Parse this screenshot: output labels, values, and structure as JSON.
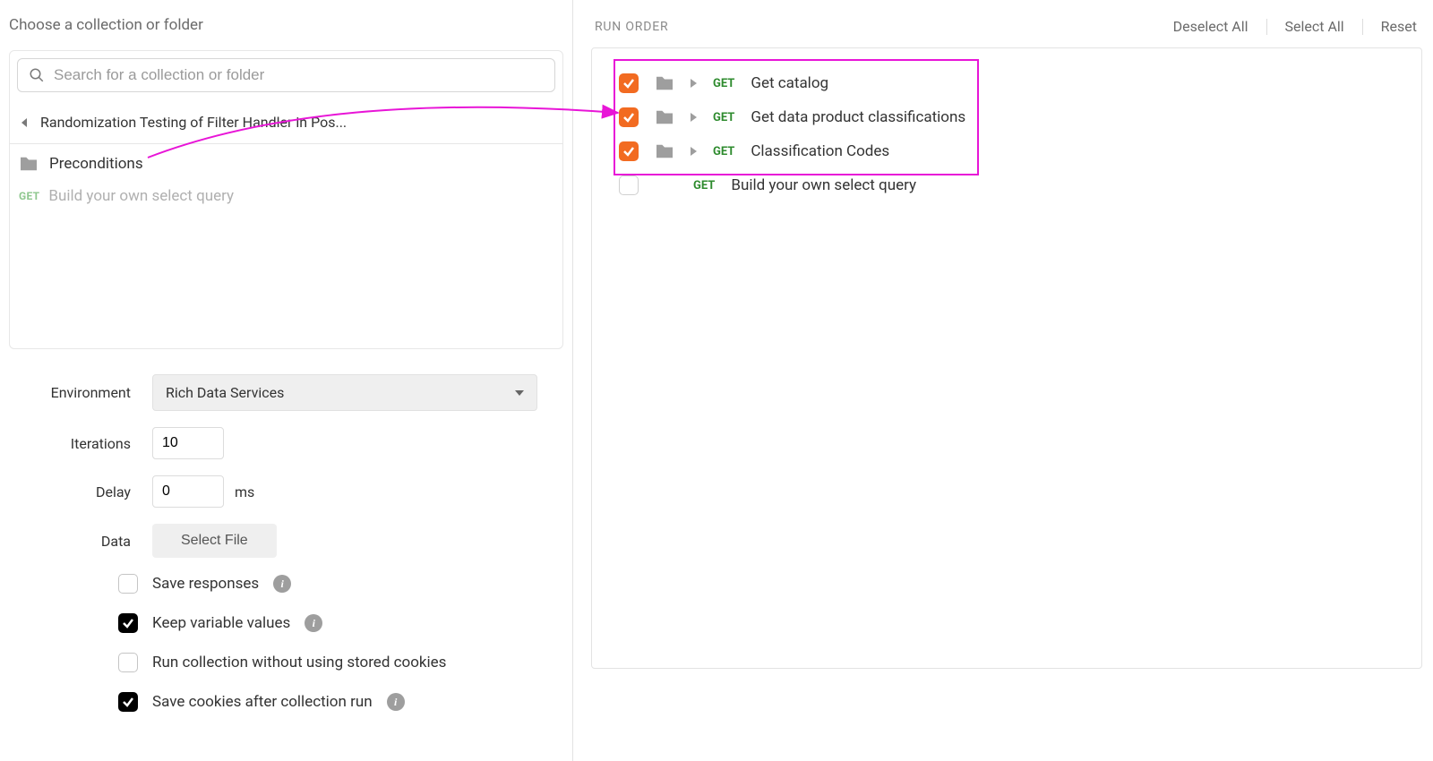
{
  "left": {
    "title": "Choose a collection or folder",
    "search_placeholder": "Search for a collection or folder",
    "breadcrumb": "Randomization Testing of Filter Handler in Pos...",
    "folder_name": "Preconditions",
    "request_method": "GET",
    "request_name": "Build your own select query"
  },
  "form": {
    "env_label": "Environment",
    "env_value": "Rich Data Services",
    "iter_label": "Iterations",
    "iter_value": "10",
    "delay_label": "Delay",
    "delay_value": "0",
    "delay_unit": "ms",
    "data_label": "Data",
    "select_file": "Select File",
    "opt_save_responses": "Save responses",
    "opt_keep_vars": "Keep variable values",
    "opt_no_cookies": "Run collection without using stored cookies",
    "opt_save_cookies": "Save cookies after collection run"
  },
  "right": {
    "header": "RUN ORDER",
    "deselect": "Deselect All",
    "select_all": "Select All",
    "reset": "Reset",
    "items": [
      {
        "checked": true,
        "folder": true,
        "method": "GET",
        "name": "Get catalog"
      },
      {
        "checked": true,
        "folder": true,
        "method": "GET",
        "name": "Get data product classifications"
      },
      {
        "checked": true,
        "folder": true,
        "method": "GET",
        "name": "Classification Codes"
      },
      {
        "checked": false,
        "folder": false,
        "method": "GET",
        "name": "Build your own select query"
      }
    ]
  }
}
